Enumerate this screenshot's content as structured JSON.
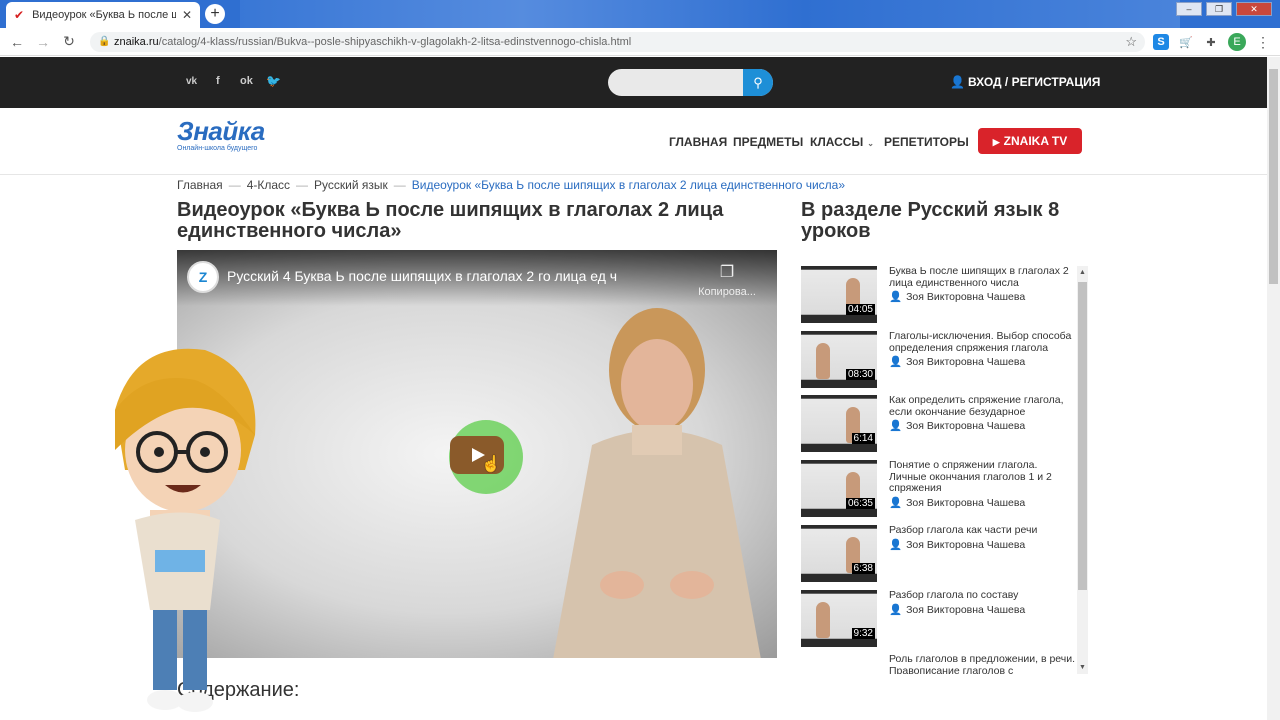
{
  "browser": {
    "tab_title": "Видеоурок «Буква Ь после ши",
    "url_domain": "znaika.ru",
    "url_path": "/catalog/4-klass/russian/Bukva--posle-shipyaschikh-v-glagolakh-2-litsa-edinstvennogo-chisla.html",
    "profile_initial": "E"
  },
  "header": {
    "social": [
      "vk",
      "f",
      "ok",
      "tw"
    ],
    "search_placeholder": "",
    "login_label": "ВХОД / РЕГИСТРАЦИЯ"
  },
  "nav": {
    "logo_name": "Знайка",
    "logo_tagline": "Онлайн-школа будущего",
    "items": [
      "ГЛАВНАЯ",
      "ПРЕДМЕТЫ",
      "КЛАССЫ",
      "РЕПЕТИТОРЫ"
    ],
    "tv_label": "ZNAIKA TV"
  },
  "breadcrumb": [
    "Главная",
    "4-Класс",
    "Русский язык",
    "Видеоурок «Буква Ь после шипящих в глаголах 2 лица единственного числа»"
  ],
  "page_title": "Видеоурок «Буква Ь после шипящих в глаголах 2 лица единственного числа»",
  "video": {
    "channel_initial": "Z",
    "title": "Русский 4 Буква Ь после шипящих в глаголах 2 го лица ед ч",
    "copy_label": "Копирова..."
  },
  "contents_heading": "Содержание:",
  "sidebar": {
    "title": "В разделе Русский язык 8 уроков",
    "videos": [
      {
        "title": "Буква Ь после шипящих в глаголах 2 лица единственного числа",
        "author": "Зоя Викторовна Чашева",
        "duration": "04:05"
      },
      {
        "title": "Глаголы-исключения. Выбор способа определения спряжения глагола",
        "author": "Зоя Викторовна Чашева",
        "duration": "08:30"
      },
      {
        "title": "Как определить спряжение глагола, если окончание безударное",
        "author": "Зоя Викторовна Чашева",
        "duration": "6:14"
      },
      {
        "title": "Понятие о спряжении глагола. Личные окончания глаголов 1 и 2 спряжения",
        "author": "Зоя Викторовна Чашева",
        "duration": "06:35"
      },
      {
        "title": "Разбор глагола как части речи",
        "author": "Зоя Викторовна Чашева",
        "duration": "6:38"
      },
      {
        "title": "Разбор глагола по составу",
        "author": "Зоя Викторовна Чашева",
        "duration": "9:32"
      },
      {
        "title": "Роль глаголов в предложении, в речи. Правописание глаголов с",
        "author": "",
        "duration": ""
      }
    ]
  }
}
